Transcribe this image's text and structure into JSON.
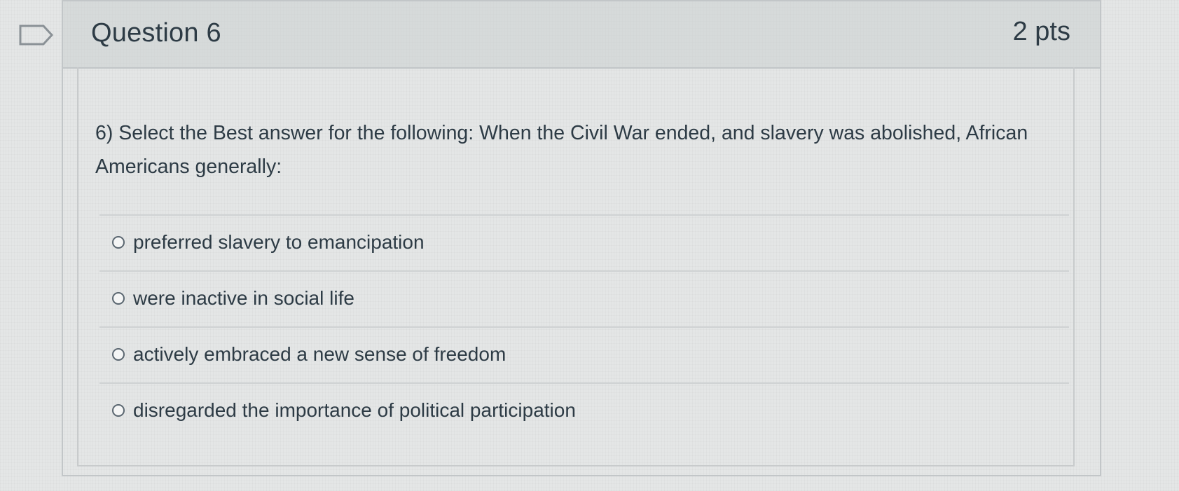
{
  "question": {
    "title": "Question 6",
    "points": "2 pts",
    "text": "6) Select the Best answer for the following: When the Civil War ended, and slavery was abolished, African Americans generally:",
    "answers": [
      {
        "label": "preferred slavery to emancipation",
        "selected": false
      },
      {
        "label": "were inactive in social life",
        "selected": false
      },
      {
        "label": "actively embraced a new sense of freedom",
        "selected": false
      },
      {
        "label": "disregarded the importance of political participation",
        "selected": false
      }
    ]
  },
  "icons": {
    "flag": "bookmark-flag-icon"
  },
  "colors": {
    "text": "#2d3b45",
    "header_bg": "#cbcfd0",
    "border": "#c2c6c8"
  }
}
